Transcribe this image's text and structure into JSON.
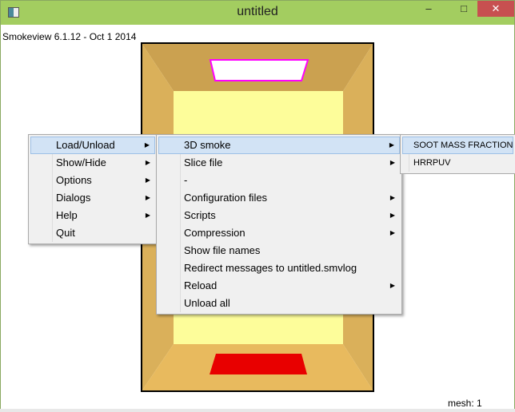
{
  "window": {
    "title": "untitled",
    "minimize": "–",
    "maximize": "□",
    "close": "✕"
  },
  "viewer": {
    "version": "Smokeview 6.1.12 - Oct  1 2014",
    "mesh": "mesh: 1"
  },
  "menu_main": [
    {
      "label": "Load/Unload",
      "submenu": true
    },
    {
      "label": "Show/Hide",
      "submenu": true
    },
    {
      "label": "Options",
      "submenu": true
    },
    {
      "label": "Dialogs",
      "submenu": true
    },
    {
      "label": "Help",
      "submenu": true
    },
    {
      "label": "Quit",
      "submenu": false
    }
  ],
  "menu_load": [
    {
      "label": "3D smoke",
      "submenu": true
    },
    {
      "label": "Slice file",
      "submenu": true
    },
    {
      "label": "-",
      "submenu": false
    },
    {
      "label": "Configuration files",
      "submenu": true
    },
    {
      "label": "Scripts",
      "submenu": true
    },
    {
      "label": "Compression",
      "submenu": true
    },
    {
      "label": "Show file names",
      "submenu": false
    },
    {
      "label": "Redirect messages to untitled.smvlog",
      "submenu": false
    },
    {
      "label": "Reload",
      "submenu": true
    },
    {
      "label": "Unload all",
      "submenu": false
    }
  ],
  "menu_smoke": [
    {
      "label": "SOOT MASS FRACTION"
    },
    {
      "label": "HRRPUV"
    }
  ],
  "arrow": "▶"
}
